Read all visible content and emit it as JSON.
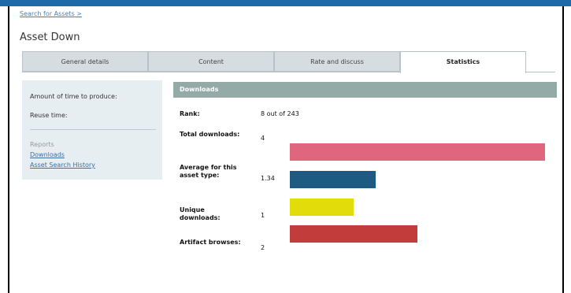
{
  "breadcrumb": {
    "link": "Search for Assets",
    "separator": ">"
  },
  "page_title": "Asset Down",
  "tabs": [
    {
      "label": "General details"
    },
    {
      "label": "Content"
    },
    {
      "label": "Rate and discuss"
    },
    {
      "label": "Statistics",
      "active": true
    }
  ],
  "sidebar": {
    "production_time_label": "Amount of time to produce:",
    "reuse_time_label": "Reuse time:",
    "reports_heading": "Reports",
    "links": [
      "Downloads",
      "Asset Search History"
    ]
  },
  "downloads": {
    "header": "Downloads",
    "rank_label": "Rank:",
    "rank_value": "8 out of 243",
    "rows": [
      {
        "label": "Total downloads:",
        "value": "4",
        "color": "#e0667d"
      },
      {
        "label": "Average for this asset type:",
        "value": "1.34",
        "color": "#1f5a82"
      },
      {
        "label": "Unique downloads:",
        "value": "1",
        "color": "#e2dd0a"
      },
      {
        "label": "Artifact browses:",
        "value": "2",
        "color": "#c33c3c"
      }
    ]
  }
}
